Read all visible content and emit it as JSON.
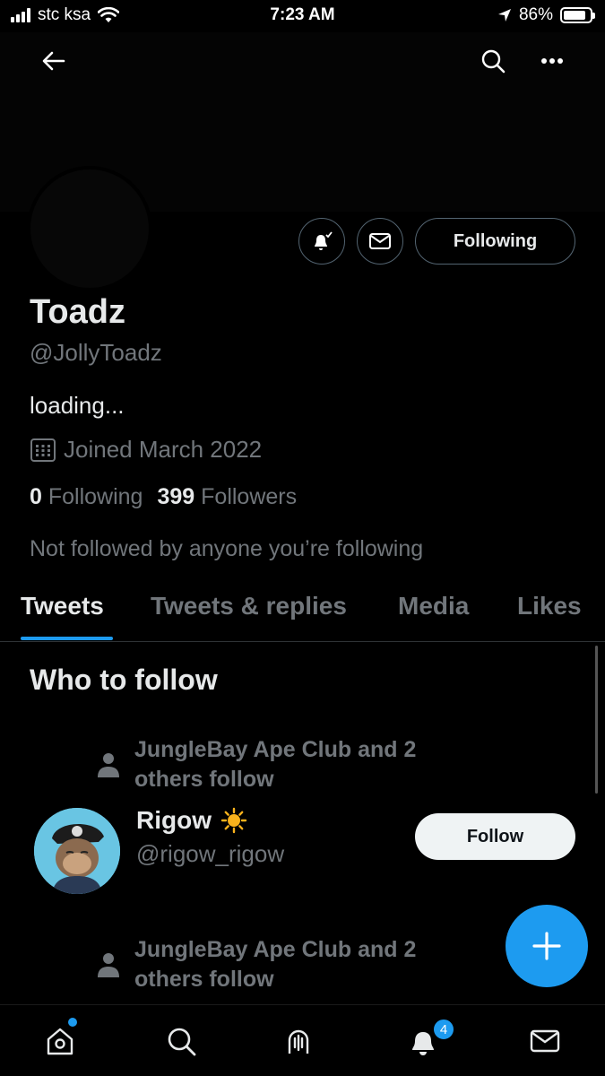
{
  "status_bar": {
    "carrier": "stc ksa",
    "time": "7:23 AM",
    "battery": "86%",
    "battery_level": 0.86
  },
  "header": {
    "back_icon": "back-arrow-icon",
    "search_icon": "search-icon",
    "more_icon": "more-icon"
  },
  "profile": {
    "display_name": "Toadz",
    "handle": "@JollyToadz",
    "bio": "loading...",
    "joined": "Joined March 2022",
    "following_count": "0",
    "following_label": "Following",
    "followers_count": "399",
    "followers_label": "Followers",
    "not_followed": "Not followed by anyone you’re following",
    "following_button": "Following"
  },
  "tabs": [
    {
      "label": "Tweets",
      "active": true
    },
    {
      "label": "Tweets & replies",
      "active": false
    },
    {
      "label": "Media",
      "active": false
    },
    {
      "label": "Likes",
      "active": false
    }
  ],
  "who_to_follow": {
    "title": "Who to follow",
    "context_1": [
      "JungleBay Ape Club and 2",
      "others follow"
    ],
    "user": {
      "name": "Rigow",
      "emoji": "☀️",
      "handle": "@rigow_rigow",
      "follow_label": "Follow"
    },
    "context_2": [
      "JungleBay Ape Club and 2",
      "others follow"
    ]
  },
  "bottom_nav": {
    "notifications_badge": "4"
  },
  "colors": {
    "accent": "#1d9bf0",
    "background": "#000000",
    "muted": "#71767b"
  }
}
